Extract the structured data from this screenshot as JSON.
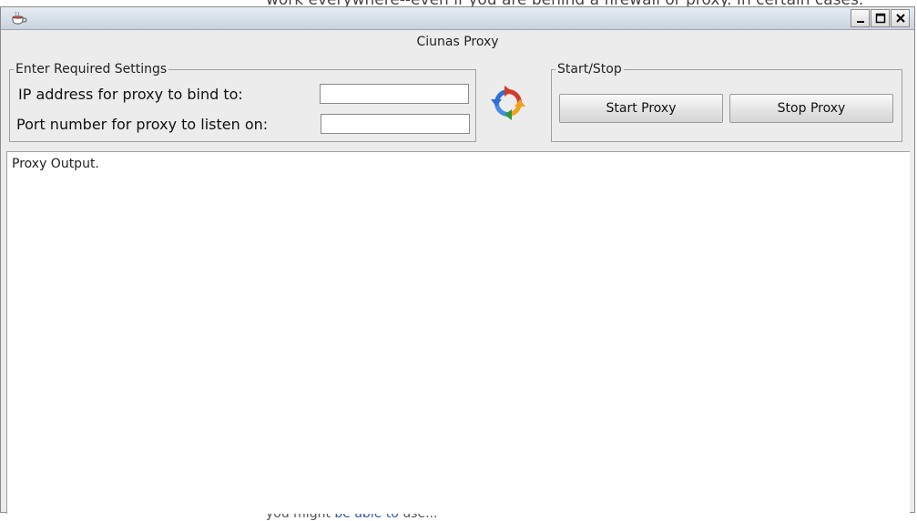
{
  "background": {
    "top_text": "work everywhere--even if you are behind a firewall or proxy. In certain cases.",
    "bottom_text_a": "you might ",
    "bottom_link": "be able to",
    "bottom_text_b": " use..."
  },
  "window": {
    "icon": "coffee-cup-icon",
    "frame_title": "Ciunas Proxy",
    "controls": {
      "minimize": "minimize-icon",
      "maximize": "maximize-icon",
      "close": "close-icon"
    }
  },
  "settings": {
    "legend": "Enter Required Settings",
    "ip_label": "IP address for proxy to bind to:",
    "ip_value": "",
    "port_label": "Port number for proxy to listen on:",
    "port_value": ""
  },
  "refresh_icon": "refresh-icon",
  "start_stop": {
    "legend": "Start/Stop",
    "start_label": "Start Proxy",
    "stop_label": "Stop Proxy"
  },
  "output": {
    "text": "Proxy Output."
  },
  "colors": {
    "titlebar": "#c9d3dd",
    "panel": "#ececec",
    "refresh_blue": "#2f6fd6",
    "refresh_orange": "#f2a21a",
    "refresh_red": "#d23a2a",
    "refresh_green": "#2f9a3a"
  }
}
